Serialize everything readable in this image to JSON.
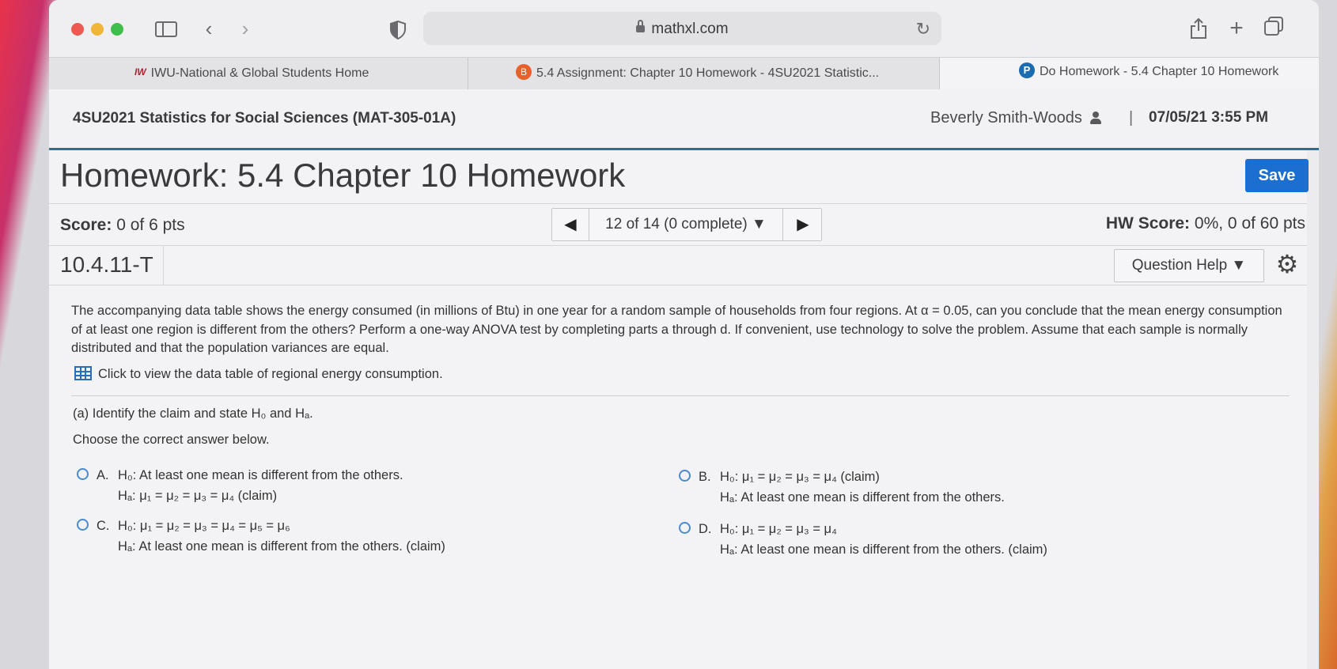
{
  "browser": {
    "url": "mathxl.com",
    "tabs": [
      {
        "favicon": "iwu-logo",
        "title": "IWU-National & Global Students Home"
      },
      {
        "favicon": "B",
        "title": "5.4 Assignment: Chapter 10 Homework - 4SU2021 Statistic..."
      },
      {
        "favicon": "P",
        "title": "Do Homework - 5.4 Chapter 10 Homework",
        "active": true
      }
    ]
  },
  "course": {
    "title": "4SU2021 Statistics for Social Sciences (MAT-305-01A)",
    "user": "Beverly Smith-Woods",
    "separator": "|",
    "datetime": "07/05/21 3:55 PM"
  },
  "homework": {
    "title": "Homework: 5.4 Chapter 10 Homework",
    "save_label": "Save",
    "score_label": "Score:",
    "score_value": "0 of 6 pts",
    "nav_label": "12 of 14 (0 complete) ▼",
    "hw_score_label": "HW Score:",
    "hw_score_value": "0%, 0 of 60 pts",
    "question_id": "10.4.11-T",
    "question_help": "Question Help ▼"
  },
  "question": {
    "text": "The accompanying data table shows the energy consumed (in millions of Btu) in one year for a random sample of households from four regions. At α = 0.05, can you conclude that the mean energy consumption of at least one region is different from the others? Perform a one-way ANOVA test by completing parts a through d. If convenient, use technology to solve the problem. Assume that each sample is normally distributed and that the population variances are equal.",
    "table_link": "Click to view the data table of regional energy consumption.",
    "part_a": "(a) Identify the claim and state H₀ and Hₐ.",
    "instruction": "Choose the correct answer below.",
    "options": [
      {
        "letter": "A.",
        "line1": "H₀: At least one mean is different from the others.",
        "line2": "Hₐ: μ₁ = μ₂ = μ₃ = μ₄ (claim)"
      },
      {
        "letter": "B.",
        "line1": "H₀: μ₁ = μ₂ = μ₃ = μ₄ (claim)",
        "line2": "Hₐ: At least one mean is different from the others."
      },
      {
        "letter": "C.",
        "line1": "H₀: μ₁ = μ₂ = μ₃ = μ₄ = μ₅ = μ₆",
        "line2": "Hₐ: At least one mean is different from the others. (claim)"
      },
      {
        "letter": "D.",
        "line1": "H₀: μ₁ = μ₂ = μ₃ = μ₄",
        "line2": "Hₐ: At least one mean is different from the others. (claim)"
      }
    ]
  },
  "colors": {
    "save_button": "#1b6fd0",
    "radio_border": "#4a8ad0",
    "header_rule": "#2c6e9a"
  }
}
